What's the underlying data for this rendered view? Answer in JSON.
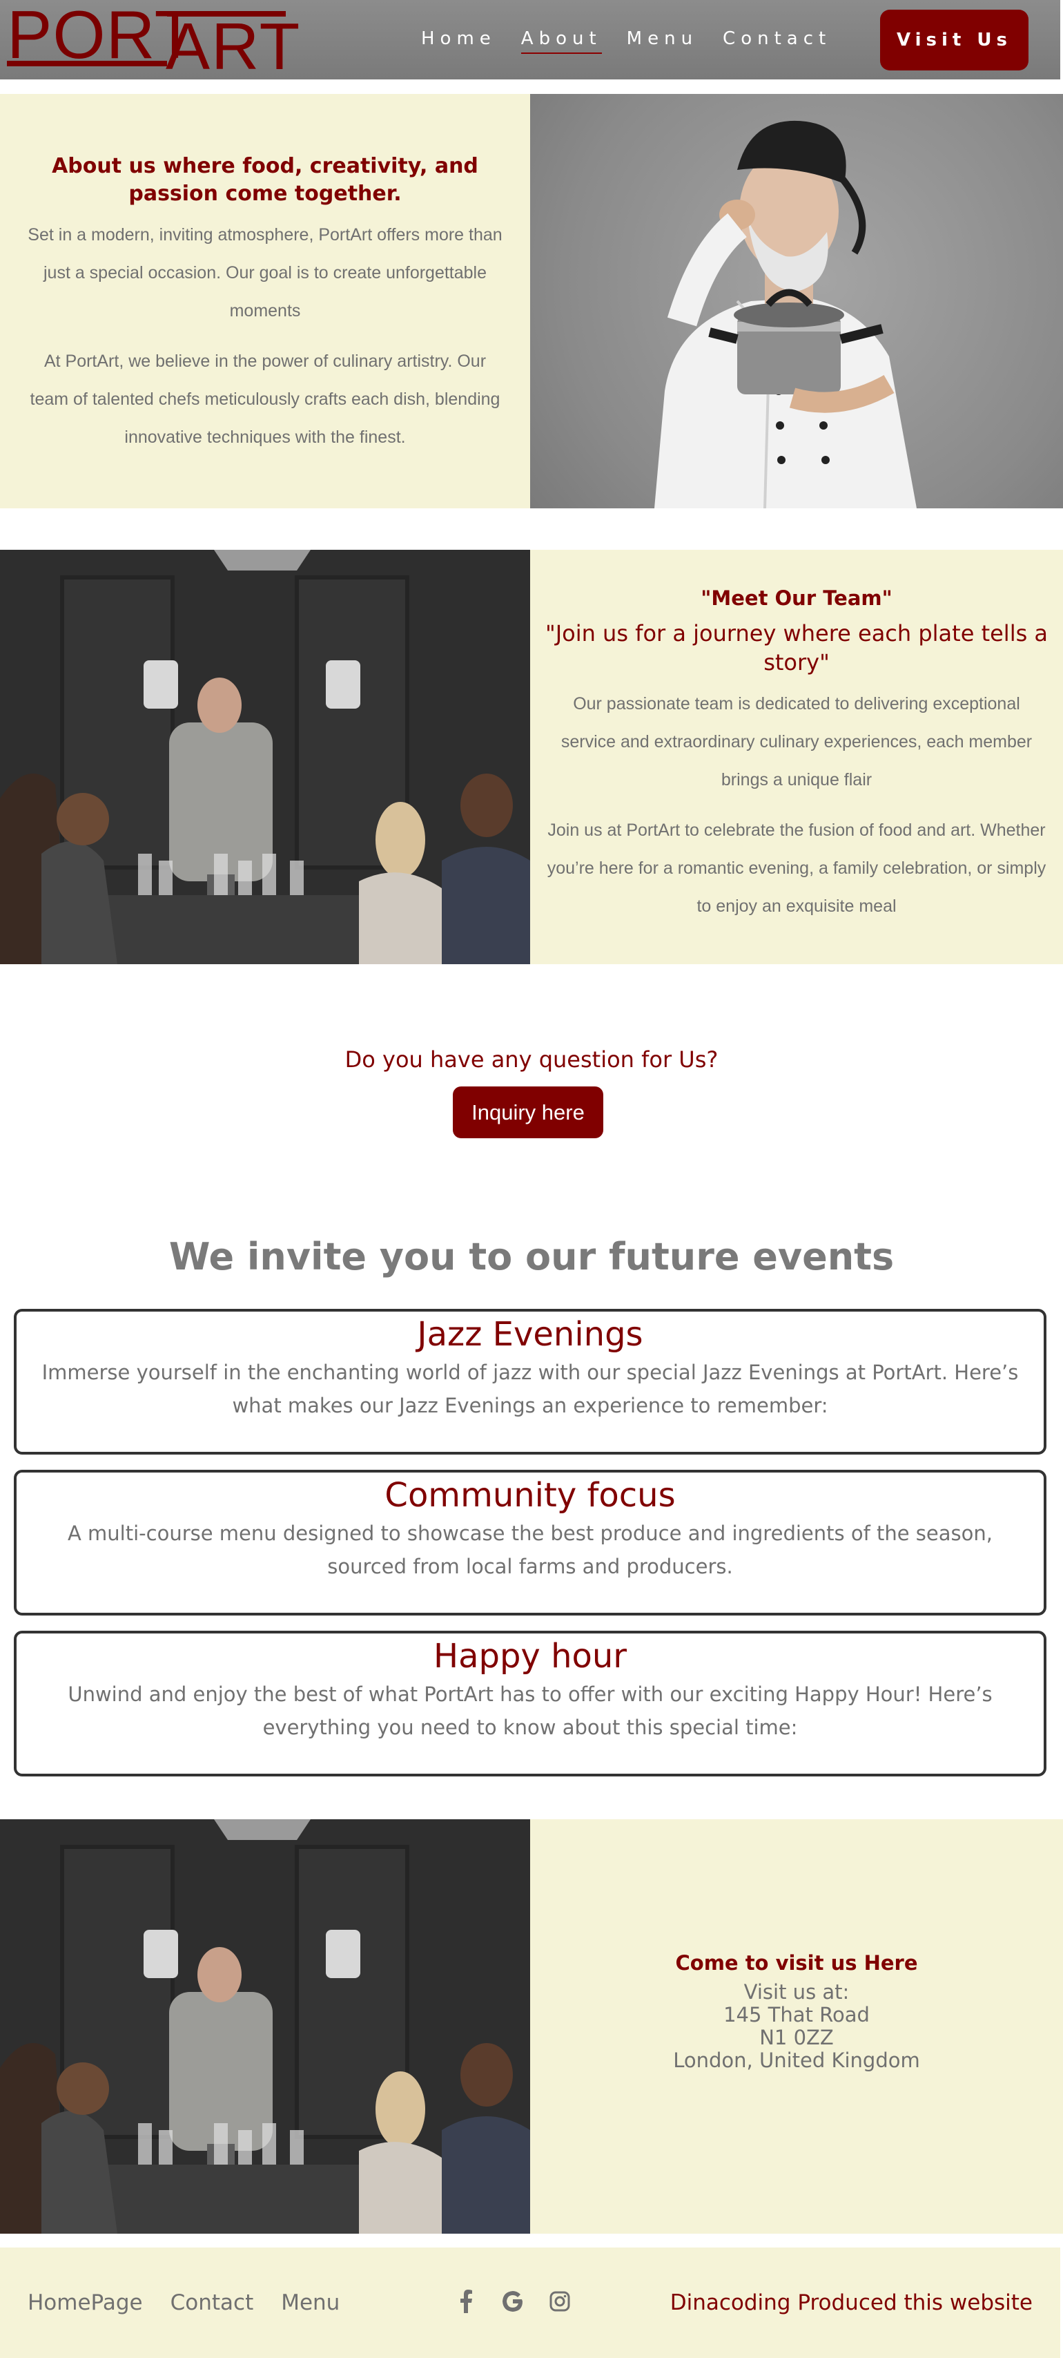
{
  "nav": {
    "logo": {
      "top": "PORT",
      "bottom": "ART"
    },
    "links": [
      {
        "label": "Home"
      },
      {
        "label": "About"
      },
      {
        "label": "Menu"
      },
      {
        "label": "Contact"
      }
    ],
    "active_link": "About",
    "visit_button": "Visit Us"
  },
  "about": {
    "heading": "About us where food, creativity, and passion come together.",
    "paragraph_1": "Set in a modern, inviting atmosphere, PortArt offers more than just a special occasion. Our goal is to create unforgettable moments",
    "paragraph_2": "At PortArt, we believe in the power of culinary artistry. Our team of talented chefs meticulously crafts each dish, blending innovative techniques with the finest."
  },
  "team": {
    "heading": "\"Meet Our Team\"",
    "subheading": "\"Join us for a journey where each plate tells a story\"",
    "paragraph_1": "Our passionate team is dedicated to delivering exceptional service and extraordinary culinary experiences, each member brings a unique flair",
    "paragraph_2": "Join us at PortArt to celebrate the fusion of food and art. Whether you’re here for a romantic evening, a family celebration, or simply to enjoy an exquisite meal"
  },
  "inquiry": {
    "question": "Do you have any question for Us?",
    "button": "Inquiry here"
  },
  "events": {
    "title": "We invite you to our future events",
    "items": [
      {
        "title": "Jazz Evenings",
        "text": "Immerse yourself in the enchanting world of jazz with our special Jazz Evenings at PortArt. Here’s what makes our Jazz Evenings an experience to remember:"
      },
      {
        "title": "Community focus",
        "text": "A multi-course menu designed to showcase the best produce and ingredients of the season, sourced from local farms and producers."
      },
      {
        "title": "Happy hour",
        "text": "Unwind and enjoy the best of what PortArt has to offer with our exciting Happy Hour! Here’s everything you need to know about this special time:"
      }
    ]
  },
  "visit": {
    "heading": "Come to visit us Here",
    "lines": [
      "Visit us at:",
      "145 That Road",
      "N1 0ZZ",
      "London, United Kingdom"
    ]
  },
  "footer": {
    "links": [
      {
        "label": "HomePage"
      },
      {
        "label": "Contact"
      },
      {
        "label": "Menu"
      }
    ],
    "icons": [
      "facebook-icon",
      "google-icon",
      "instagram-icon"
    ],
    "credit": "Dinacoding Produced this website"
  },
  "colors": {
    "brand": "#800000",
    "cream": "#f5f3d7",
    "nav_bg": "#858585",
    "body_text": "#707070"
  }
}
